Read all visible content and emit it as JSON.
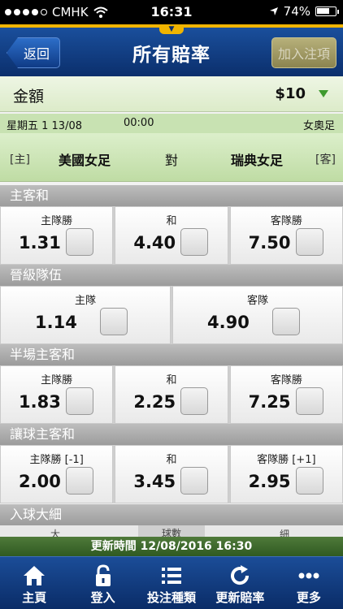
{
  "status_bar": {
    "carrier": "CMHK",
    "time": "16:31",
    "battery": "74%",
    "battery_level": 0.74
  },
  "nav": {
    "back_label": "返回",
    "title": "所有賠率",
    "join_label": "加入注項"
  },
  "amount": {
    "label": "金額",
    "value": "$10"
  },
  "match": {
    "date": "星期五 1 13/08",
    "time": "00:00",
    "league": "女奧足",
    "home_tag": "[主]",
    "home_team": "美國女足",
    "vs": "對",
    "away_team": "瑞典女足",
    "away_tag": "[客]"
  },
  "markets": [
    {
      "title": "主客和",
      "options": [
        {
          "name": "主隊勝",
          "odds": "1.31"
        },
        {
          "name": "和",
          "odds": "4.40"
        },
        {
          "name": "客隊勝",
          "odds": "7.50"
        }
      ]
    },
    {
      "title": "晉級隊伍",
      "options": [
        {
          "name": "主隊",
          "odds": "1.14"
        },
        {
          "name": "客隊",
          "odds": "4.90"
        }
      ]
    },
    {
      "title": "半場主客和",
      "options": [
        {
          "name": "主隊勝",
          "odds": "1.83"
        },
        {
          "name": "和",
          "odds": "2.25"
        },
        {
          "name": "客隊勝",
          "odds": "7.25"
        }
      ]
    },
    {
      "title": "讓球主客和",
      "options": [
        {
          "name": "主隊勝 [-1]",
          "odds": "2.00"
        },
        {
          "name": "和",
          "odds": "3.45"
        },
        {
          "name": "客隊勝 [+1]",
          "odds": "2.95"
        }
      ]
    },
    {
      "title": "入球大細",
      "options": []
    }
  ],
  "partial_row": {
    "left": "大",
    "middle": "球數",
    "right": "細"
  },
  "update": {
    "text": "更新時間 12/08/2016 16:30"
  },
  "tabs": [
    {
      "label": "主頁",
      "icon": "home-icon"
    },
    {
      "label": "登入",
      "icon": "lock-icon"
    },
    {
      "label": "投注種類",
      "icon": "list-icon"
    },
    {
      "label": "更新賠率",
      "icon": "refresh-icon"
    },
    {
      "label": "更多",
      "icon": "more-icon"
    }
  ],
  "colors": {
    "nav_blue": "#0b2f6c",
    "accent_gold": "#f0b400",
    "green_bar": "#2f5a22"
  }
}
